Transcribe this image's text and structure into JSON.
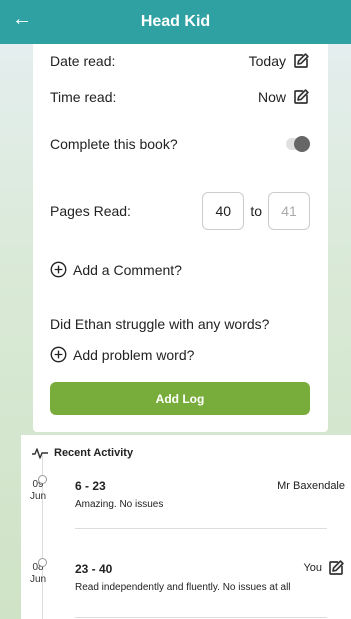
{
  "header": {
    "back_icon": "arrow-left-icon",
    "title": "Head Kid",
    "color": "#2fa1a3"
  },
  "form": {
    "date_label": "Date read:",
    "date_value": "Today",
    "time_label": "Time read:",
    "time_value": "Now",
    "complete_label": "Complete this book?",
    "complete_toggle": false,
    "pages_label": "Pages Read:",
    "pages_from": "40",
    "pages_to_word": "to",
    "pages_to_placeholder": "41",
    "add_comment": "Add a Comment?",
    "struggle_question": "Did Ethan struggle with any words?",
    "add_problem_word": "Add problem word?",
    "add_log_button": "Add Log",
    "button_color": "#79ad3b"
  },
  "recent": {
    "heading": "Recent Activity",
    "icon": "activity-pulse-icon",
    "entries": [
      {
        "day": "09",
        "month": "Jun",
        "range": "6 - 23",
        "by": "Mr Baxendale",
        "comment": "Amazing. No issues",
        "editable": false
      },
      {
        "day": "08",
        "month": "Jun",
        "range": "23 - 40",
        "by": "You",
        "comment": "Read independently and fluently. No issues at all",
        "editable": true
      }
    ]
  }
}
